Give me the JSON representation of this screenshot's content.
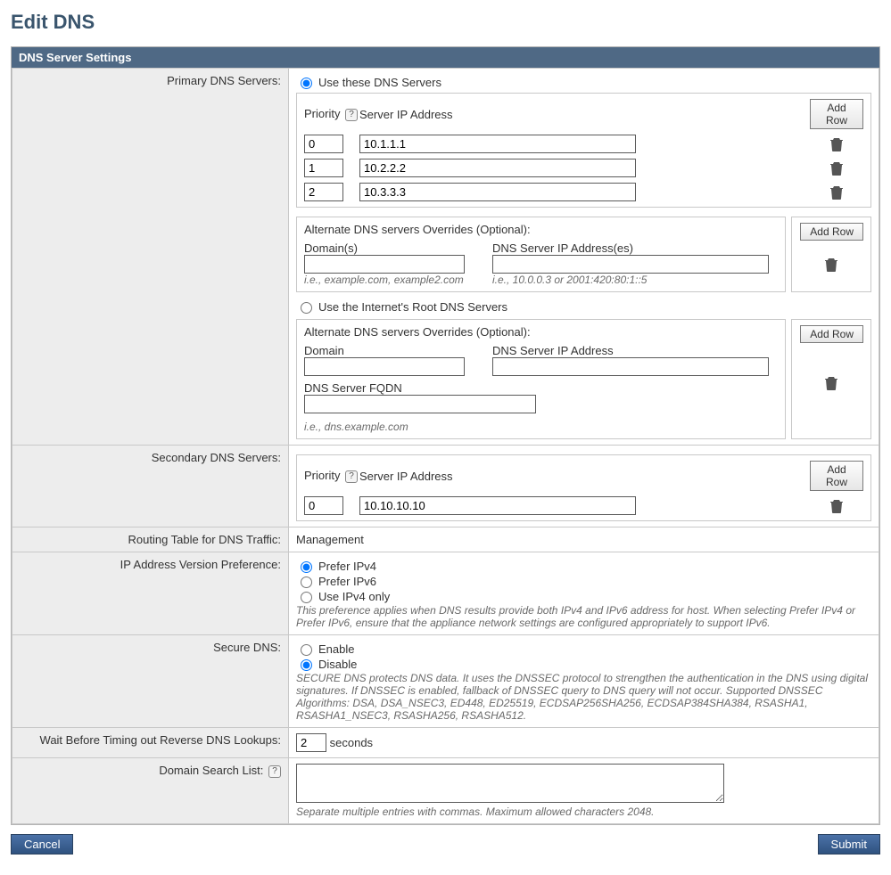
{
  "title": "Edit DNS",
  "panel_header": "DNS Server Settings",
  "labels": {
    "primary_dns": "Primary DNS Servers:",
    "secondary_dns": "Secondary DNS Servers:",
    "routing_table": "Routing Table for DNS Traffic:",
    "ip_pref": "IP Address Version Preference:",
    "secure_dns": "Secure DNS:",
    "wait_timeout": "Wait Before Timing out Reverse DNS Lookups:",
    "domain_search": "Domain Search List:"
  },
  "primary": {
    "radio_use_these": "Use these DNS Servers",
    "radio_root": "Use the Internet's Root DNS Servers",
    "col_priority": "Priority",
    "col_server": "Server IP Address",
    "add_row": "Add Row",
    "rows": [
      {
        "priority": "0",
        "ip": "10.1.1.1"
      },
      {
        "priority": "1",
        "ip": "10.2.2.2"
      },
      {
        "priority": "2",
        "ip": "10.3.3.3"
      }
    ],
    "alt_header": "Alternate DNS servers Overrides (Optional):",
    "alt_col_domains": "Domain(s)",
    "alt_col_ips": "DNS Server IP Address(es)",
    "alt_hint_domains": "i.e., example.com, example2.com",
    "alt_hint_ips": "i.e., 10.0.0.3 or 2001:420:80:1::5",
    "root_alt_header": "Alternate DNS servers Overrides (Optional):",
    "root_col_domain": "Domain",
    "root_col_ip": "DNS Server IP Address",
    "root_col_fqdn": "DNS Server FQDN",
    "root_hint_fqdn": "i.e., dns.example.com"
  },
  "secondary": {
    "col_priority": "Priority",
    "col_server": "Server IP Address",
    "add_row": "Add Row",
    "rows": [
      {
        "priority": "0",
        "ip": "10.10.10.10"
      }
    ]
  },
  "routing_value": "Management",
  "ip_pref": {
    "opt1": "Prefer IPv4",
    "opt2": "Prefer IPv6",
    "opt3": "Use IPv4 only",
    "hint": "This preference applies when DNS results provide both IPv4 and IPv6 address for host. When selecting Prefer IPv4 or Prefer IPv6, ensure that the appliance network settings are configured appropriately to support IPv6."
  },
  "secure": {
    "opt_enable": "Enable",
    "opt_disable": "Disable",
    "hint": "SECURE DNS protects DNS data. It uses the DNSSEC protocol to strengthen the authentication in the DNS using digital signatures. If DNSSEC is enabled, fallback of DNSSEC query to DNS query will not occur. Supported DNSSEC Algorithms: DSA, DSA_NSEC3, ED448, ED25519, ECDSAP256SHA256, ECDSAP384SHA384, RSASHA1, RSASHA1_NSEC3, RSASHA256, RSASHA512."
  },
  "timeout": {
    "value": "2",
    "unit": "seconds"
  },
  "domain_search_hint": "Separate multiple entries with commas. Maximum allowed characters 2048.",
  "buttons": {
    "cancel": "Cancel",
    "submit": "Submit"
  }
}
